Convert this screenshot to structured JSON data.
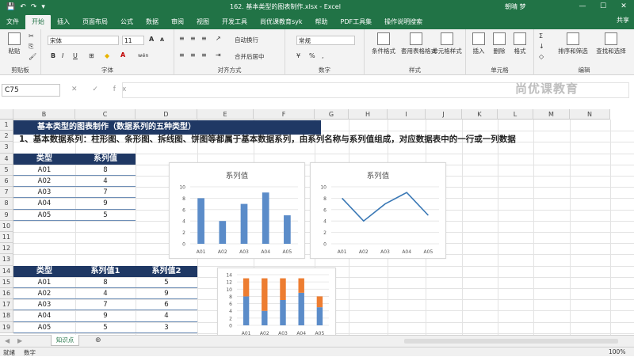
{
  "titlebar": {
    "title": "162. 基本类型的图表制作.xlsx - Excel",
    "user": "朝晴 梦",
    "icons": [
      "save-icon",
      "undo-icon",
      "redo-icon"
    ],
    "win_min": "—",
    "win_max": "☐",
    "win_close": "✕"
  },
  "tabs": [
    "文件",
    "开始",
    "插入",
    "页面布局",
    "公式",
    "数据",
    "审阅",
    "视图",
    "开发工具",
    "尚优课教育syk",
    "帮助",
    "PDF工具集",
    "操作说明搜索"
  ],
  "active_tab": "开始",
  "share_label": "共享",
  "ribbon": {
    "clipboard": {
      "paste": "粘贴",
      "label": "剪贴板"
    },
    "font": {
      "name": "宋体",
      "size": "11",
      "bold": "B",
      "italic": "I",
      "underline": "U",
      "grow": "A",
      "shrink": "A",
      "label": "字体",
      "wen": "wén"
    },
    "align": {
      "wrap": "自动换行",
      "merge": "合并后居中",
      "label": "对齐方式"
    },
    "number": {
      "format": "常规",
      "label": "数字"
    },
    "styles": {
      "conditional": "条件格式",
      "table": "套用表格格式",
      "cell": "单元格样式",
      "label": "样式"
    },
    "cells": {
      "insert": "插入",
      "delete": "删除",
      "format": "格式",
      "label": "单元格"
    },
    "editing": {
      "sort": "排序和筛选",
      "find": "查找和选择",
      "label": "编辑"
    }
  },
  "formula_bar": {
    "cell_ref": "C75",
    "icons": "✕ ✓ fx",
    "content": ""
  },
  "watermark": "尚优课教育",
  "columns": [
    "B",
    "C",
    "D",
    "E",
    "F",
    "G",
    "H",
    "I",
    "J",
    "K",
    "L",
    "M",
    "N"
  ],
  "rows": [
    "1",
    "2",
    "3",
    "4",
    "5",
    "6",
    "7",
    "8",
    "9",
    "10",
    "11",
    "12",
    "13",
    "14",
    "15",
    "16",
    "17",
    "18",
    "19"
  ],
  "sheet": {
    "banner": "基本类型的图表制作（数据系列的五种类型）",
    "description": "1、基本数据系列：柱形图、条形图、拆线图、饼图等都属于基本数据系列，由系列名称与系列值组成，对应数据表中的一行或一列数据",
    "table1": {
      "headers": [
        "类型",
        "系列值"
      ],
      "rows": [
        [
          "A01",
          "8"
        ],
        [
          "A02",
          "4"
        ],
        [
          "A03",
          "7"
        ],
        [
          "A04",
          "9"
        ],
        [
          "A05",
          "5"
        ]
      ]
    },
    "table2": {
      "headers": [
        "类型",
        "系列值1",
        "系列值2"
      ],
      "rows": [
        [
          "A01",
          "8",
          "5"
        ],
        [
          "A02",
          "4",
          "9"
        ],
        [
          "A03",
          "7",
          "6"
        ],
        [
          "A04",
          "9",
          "4"
        ],
        [
          "A05",
          "5",
          "3"
        ]
      ]
    }
  },
  "chart_data": [
    {
      "type": "bar",
      "title": "系列值",
      "categories": [
        "A01",
        "A02",
        "A03",
        "A04",
        "A05"
      ],
      "values": [
        8,
        4,
        7,
        9,
        5
      ],
      "ylim": [
        0,
        10
      ],
      "yticks": [
        "0",
        "2",
        "4",
        "6",
        "8",
        "10"
      ],
      "color": "#5b8cc9"
    },
    {
      "type": "line",
      "title": "系列值",
      "categories": [
        "A01",
        "A02",
        "A03",
        "A04",
        "A05"
      ],
      "values": [
        8,
        4,
        7,
        9,
        5
      ],
      "ylim": [
        0,
        10
      ],
      "yticks": [
        "0",
        "2",
        "4",
        "6",
        "8",
        "10"
      ],
      "color": "#3a78b5"
    },
    {
      "type": "bar",
      "stacked": true,
      "categories": [
        "A01",
        "A02",
        "A03",
        "A04",
        "A05"
      ],
      "series": [
        {
          "values": [
            8,
            4,
            7,
            9,
            5
          ],
          "color": "#5b8cc9"
        },
        {
          "values": [
            5,
            9,
            6,
            4,
            3
          ],
          "color": "#ed7d31"
        }
      ],
      "ylim": [
        0,
        14
      ],
      "yticks": [
        "0",
        "2",
        "4",
        "6",
        "8",
        "10",
        "12",
        "14"
      ]
    }
  ],
  "sheet_tab": "知识点",
  "add_sheet": "⊕",
  "status": {
    "left": "就绪",
    "mode": "数字",
    "zoom": "100%"
  }
}
